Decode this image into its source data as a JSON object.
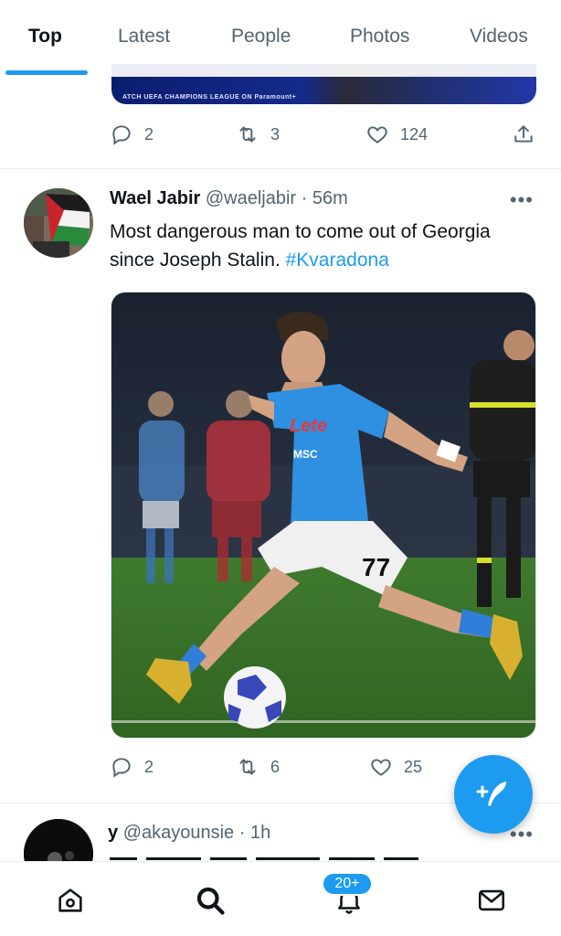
{
  "tabs": [
    {
      "label": "Top",
      "active": true
    },
    {
      "label": "Latest",
      "active": false
    },
    {
      "label": "People",
      "active": false
    },
    {
      "label": "Photos",
      "active": false
    },
    {
      "label": "Videos",
      "active": false
    }
  ],
  "prev_tweet": {
    "media_caption": "ATCH UEFA CHAMPIONS LEAGUE ON Paramount+",
    "replies": "2",
    "retweets": "3",
    "likes": "124"
  },
  "tweet": {
    "name": "Wael Jabir",
    "handle": "@waeljabir",
    "separator": "·",
    "time": "56m",
    "text": "Most dangerous man to come out of Georgia since Joseph Stalin.",
    "hashtag": "#Kvaradona",
    "photo_jersey": {
      "sponsor": "Lete",
      "club": "MSC",
      "number": "77"
    },
    "replies": "2",
    "retweets": "6",
    "likes": "25"
  },
  "next_tweet": {
    "name": "y",
    "handle": "@akayounsie",
    "separator": "·",
    "time": "1h"
  },
  "bottom_nav": {
    "notifications_badge": "20+",
    "items": [
      "home-icon",
      "search-icon",
      "notifications-icon",
      "messages-icon"
    ]
  },
  "colors": {
    "accent": "#1d9bf0",
    "text": "#0f1419",
    "secondary": "#536471"
  }
}
